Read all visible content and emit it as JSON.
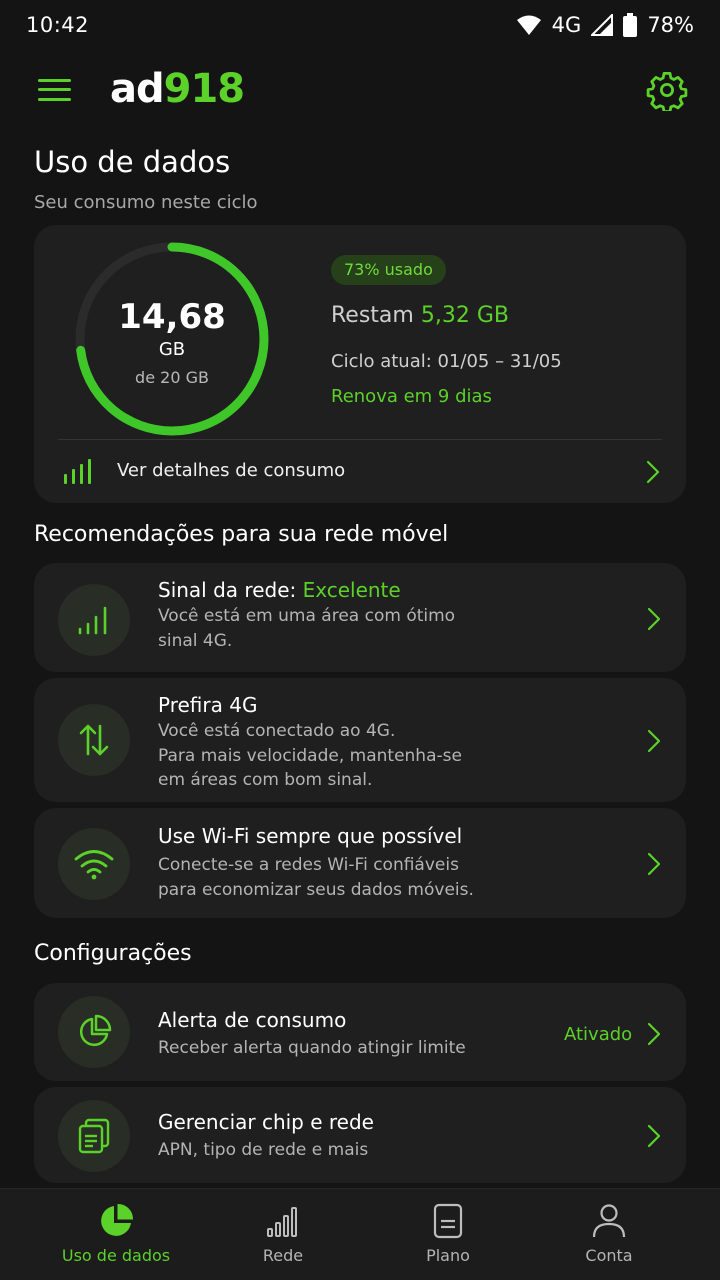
{
  "status_bar": {
    "time": "10:42",
    "network": "4G",
    "battery": "78%"
  },
  "app_bar": {
    "logo_part1": "ad",
    "logo_part2": "918",
    "menu_icon": "hamburger-menu-icon",
    "settings_icon": "gear-icon"
  },
  "page": {
    "title": "Uso de dados",
    "subtitle": "Seu consumo neste ciclo"
  },
  "usage": {
    "used_value": "14,68",
    "unit": "GB",
    "total_label": "de 20 GB",
    "used_fraction": 0.73,
    "badge": "73% usado",
    "remaining_prefix": "Restam",
    "remaining_value": "5,32 GB",
    "cycle": "Ciclo atual: 01/05 – 31/05",
    "renew": "Renova em 9 dias",
    "details_link": "Ver detalhes de consumo"
  },
  "recommendations": {
    "title": "Recomendações para sua rede móvel",
    "items": [
      {
        "title_prefix": "Sinal da rede: ",
        "title_highlight": "Excelente",
        "desc_lines": [
          "Você está em uma área com ótimo",
          "sinal 4G."
        ],
        "icon": "signal-bars-icon"
      },
      {
        "title": "Prefira 4G",
        "desc_lines": [
          "Você está conectado ao 4G.",
          "Para mais velocidade, mantenha-se",
          "em áreas com bom sinal."
        ],
        "icon": "up-down-arrows-icon"
      },
      {
        "title": "Use Wi-Fi sempre que possível",
        "desc_lines": [
          "Conecte-se a redes Wi-Fi confiáveis",
          "para economizar seus dados móveis."
        ],
        "icon": "wifi-icon"
      }
    ]
  },
  "settings": {
    "title": "Configurações",
    "items": [
      {
        "title": "Alerta de consumo",
        "desc": "Receber alerta quando atingir limite",
        "status": "Ativado",
        "icon": "pie-chart-icon"
      },
      {
        "title": "Gerenciar chip e rede",
        "desc": "APN, tipo de rede e mais",
        "icon": "sim-card-icon"
      }
    ]
  },
  "bottom_nav": {
    "items": [
      {
        "label": "Uso de dados",
        "icon": "pie-chart-icon",
        "active": true
      },
      {
        "label": "Rede",
        "icon": "signal-bars-icon",
        "active": false
      },
      {
        "label": "Plano",
        "icon": "document-icon",
        "active": false
      },
      {
        "label": "Conta",
        "icon": "person-icon",
        "active": false
      }
    ]
  },
  "colors": {
    "accent": "#5bd12a",
    "background": "#141414",
    "card": "#1f1f1f",
    "badge_bg": "#26401a"
  }
}
